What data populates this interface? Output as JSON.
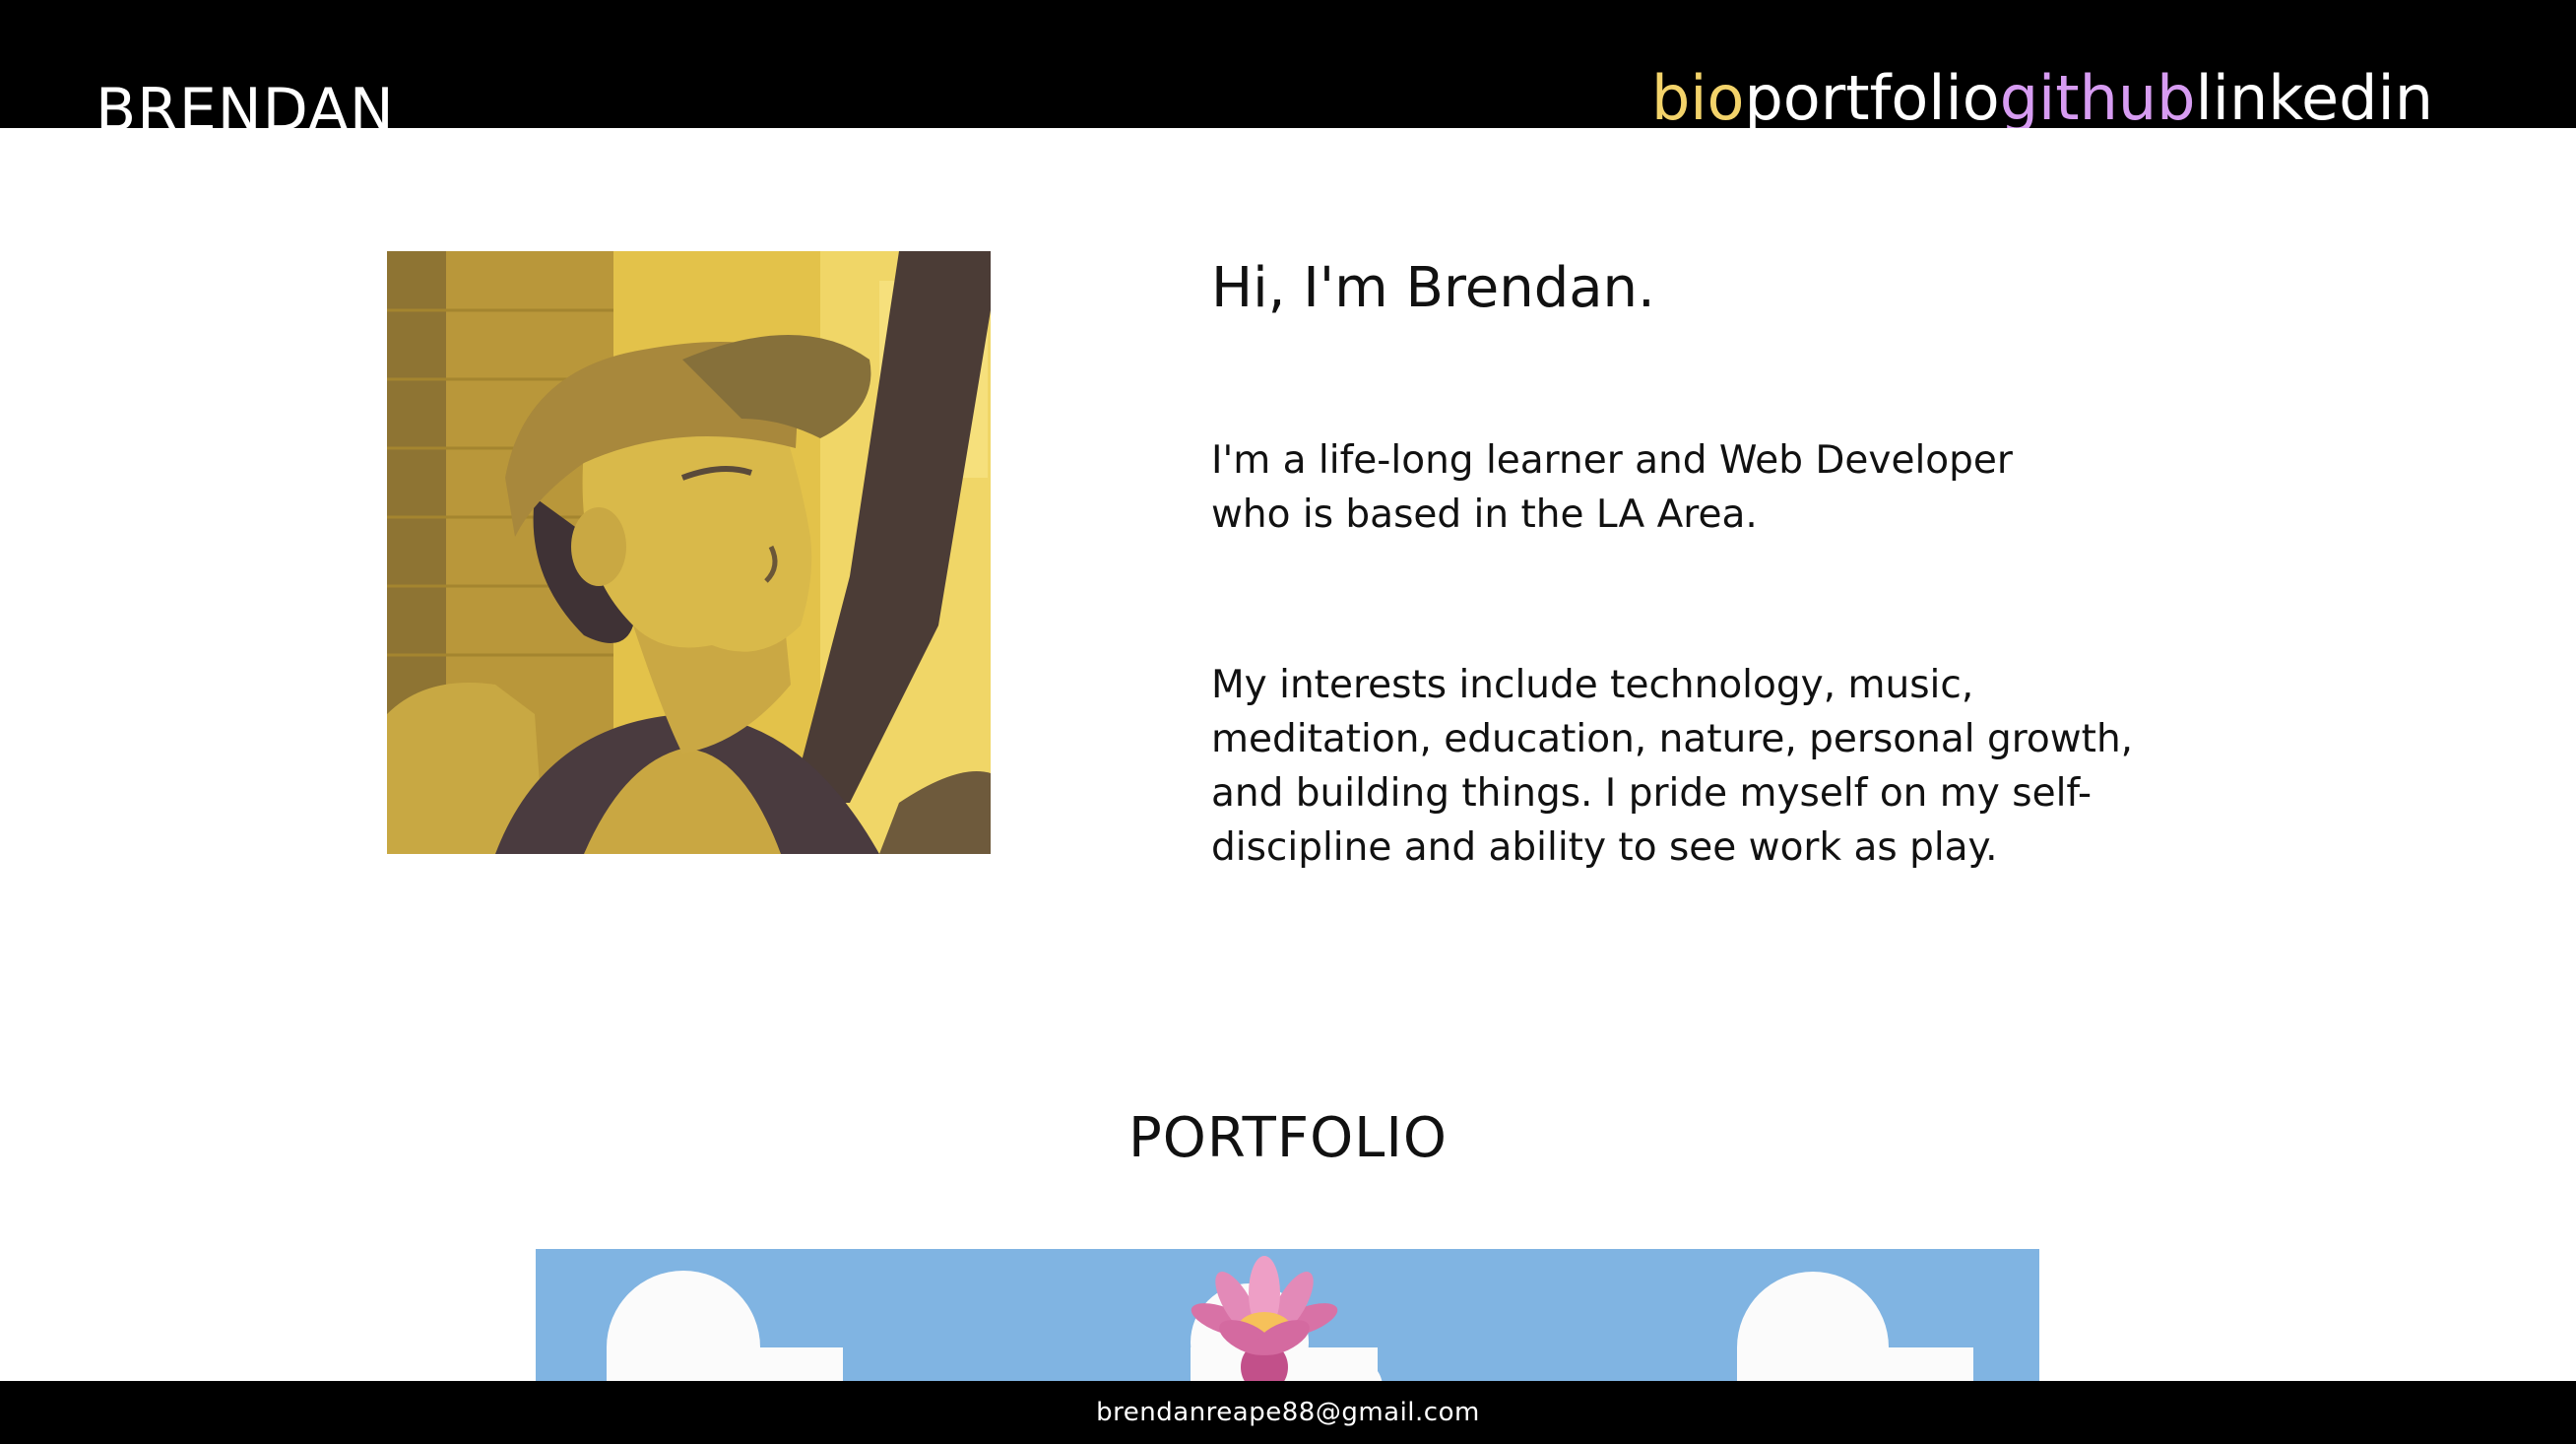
{
  "header": {
    "brand": "BRENDAN",
    "nav": [
      {
        "label": "bio",
        "color": "#f3d36a"
      },
      {
        "label": "portfolio",
        "color": "#ffffff"
      },
      {
        "label": "github",
        "color": "#d79cf2"
      },
      {
        "label": "linkedin",
        "color": "#ffffff"
      }
    ]
  },
  "bio": {
    "title": "Hi, I'm Brendan.",
    "paragraph1": "I'm a life-long learner and Web Developer who is based in the LA Area.",
    "paragraph2": "My interests include technology, music, meditation, education, nature, personal growth, and building things. I pride myself on my self-discipline and ability to see work as play."
  },
  "portfolio": {
    "heading": "PORTFOLIO",
    "card_background": "#80b4e2"
  },
  "footer": {
    "email": "brendanreape88@gmail.com"
  },
  "colors": {
    "header_bg": "#000000",
    "photo_tint": "#e8c94a",
    "photo_shadow": "#3c3035"
  }
}
